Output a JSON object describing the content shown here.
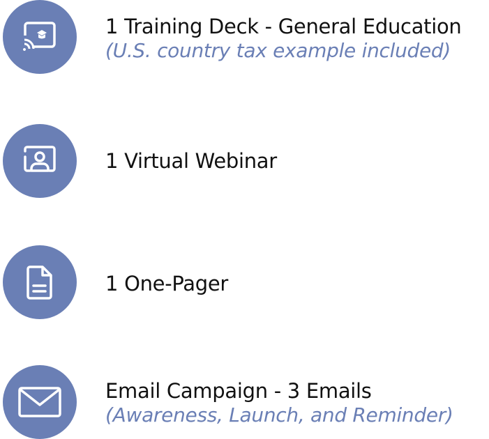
{
  "accent_color": "#6a7fb5",
  "items": [
    {
      "icon": "cast-training-icon",
      "title": "1 Training Deck - General Education",
      "subtitle": "(U.S. country tax example included)"
    },
    {
      "icon": "webinar-icon",
      "title": "1 Virtual Webinar",
      "subtitle": ""
    },
    {
      "icon": "document-icon",
      "title": "1 One-Pager",
      "subtitle": ""
    },
    {
      "icon": "email-icon",
      "title": "Email Campaign - 3 Emails",
      "subtitle": "(Awareness, Launch, and Reminder)"
    }
  ]
}
